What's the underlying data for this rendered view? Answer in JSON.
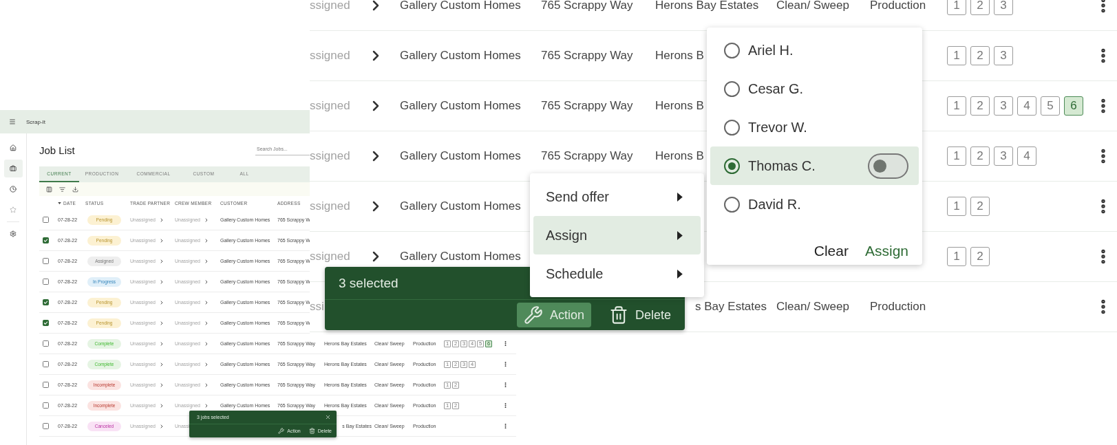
{
  "app": {
    "title": "Scrap-It",
    "nav": [
      {
        "selected": false
      },
      {
        "selected": true
      },
      {
        "selected": false
      },
      {
        "selected": false
      },
      {
        "selected": false
      }
    ],
    "page_title": "Job List",
    "search": {
      "placeholder": "Search Jobs..."
    },
    "tabs": [
      {
        "label": "CURRENT",
        "selected": true
      },
      {
        "label": "PRODUCTION",
        "selected": false
      },
      {
        "label": "COMMERCIAL",
        "selected": false
      },
      {
        "label": "CUSTOM",
        "selected": false
      },
      {
        "label": "ALL",
        "selected": false
      }
    ],
    "columns": [
      {
        "label": "DATE",
        "sorted": true
      },
      {
        "label": "STATUS",
        "sorted": false
      },
      {
        "label": "TRADE PARTNER",
        "sorted": false
      },
      {
        "label": "CREW MEMBER",
        "sorted": false
      },
      {
        "label": "CUSTOMER",
        "sorted": false
      },
      {
        "label": "ADDRESS",
        "sorted": false
      }
    ],
    "rows": [
      {
        "kind": "clipped",
        "checked": false,
        "date": "07-28-22",
        "status": {
          "label": "Pending",
          "color": "#fcf1d2"
        },
        "trade_partner": "Unassigned",
        "crew_member": "Unassigned",
        "customer": "Gallery Custom Homes",
        "address": "765 Scrappy W"
      },
      {
        "kind": "clipped",
        "checked": true,
        "date": "07-28-22",
        "status": {
          "label": "Pending",
          "color": "#fcf1d2"
        },
        "trade_partner": "Unassigned",
        "crew_member": "Unassigned",
        "customer": "Gallery Custom Homes",
        "address": "765 Scrappy W"
      },
      {
        "kind": "clipped",
        "checked": false,
        "date": "07-28-22",
        "status": {
          "label": "Assigned",
          "color": "#eeeeee"
        },
        "trade_partner": "Unassigned",
        "crew_member": "Unassigned",
        "customer": "Gallery Custom Homes",
        "address": "765 Scrappy W"
      },
      {
        "kind": "clipped",
        "checked": false,
        "date": "07-28-22",
        "status": {
          "label": "In Progress",
          "color": "#e0eff9"
        },
        "trade_partner": "Unassigned",
        "crew_member": "Unassigned",
        "customer": "Gallery Custom Homes",
        "address": "765 Scrappy W"
      },
      {
        "kind": "clipped",
        "checked": true,
        "date": "07-28-22",
        "status": {
          "label": "Pending",
          "color": "#fcf1d2"
        },
        "trade_partner": "Unassigned",
        "crew_member": "Unassigned",
        "customer": "Gallery Custom Homes",
        "address": "765 Scrappy W"
      },
      {
        "kind": "clipped",
        "checked": true,
        "date": "07-28-22",
        "status": {
          "label": "Pending",
          "color": "#fcf1d2"
        },
        "trade_partner": "Unassigned",
        "crew_member": "Unassigned",
        "customer": "Gallery Custom Homes",
        "address": "765 Scrappy W"
      },
      {
        "kind": "full",
        "checked": false,
        "date": "07-28-22",
        "status": {
          "label": "Complete",
          "color": "#e5f4e3"
        },
        "trade_partner": "Unassigned",
        "crew_member": "Unassigned",
        "customer": "Gallery Custom Homes",
        "address": "765 Scrappy Way",
        "subdivision": "Herons Bay Estates",
        "trade": "Clean/ Sweep",
        "category": "Production",
        "steps": [
          {
            "label": "1",
            "selected": false
          },
          {
            "label": "2",
            "selected": false
          },
          {
            "label": "3",
            "selected": false
          },
          {
            "label": "4",
            "selected": false
          },
          {
            "label": "5",
            "selected": false
          },
          {
            "label": "6",
            "selected": true
          }
        ],
        "menu": true
      },
      {
        "kind": "full",
        "checked": false,
        "date": "07-28-22",
        "status": {
          "label": "Complete",
          "color": "#e5f4e3"
        },
        "trade_partner": "Unassigned",
        "crew_member": "Unassigned",
        "customer": "Gallery Custom Homes",
        "address": "765 Scrappy Way",
        "subdivision": "Herons Bay Estates",
        "trade": "Clean/ Sweep",
        "category": "Production",
        "steps": [
          {
            "label": "1",
            "selected": false
          },
          {
            "label": "2",
            "selected": false
          },
          {
            "label": "3",
            "selected": false
          },
          {
            "label": "4",
            "selected": false
          }
        ],
        "menu": true
      },
      {
        "kind": "full",
        "checked": false,
        "date": "07-28-22",
        "status": {
          "label": "Incomplete",
          "color": "#fbe3e1"
        },
        "trade_partner": "Unassigned",
        "crew_member": "Unassigned",
        "customer": "Gallery Custom Homes",
        "address": "765 Scrappy Way",
        "subdivision": "Herons Bay Estates",
        "trade": "Clean/ Sweep",
        "category": "Production",
        "steps": [
          {
            "label": "1",
            "selected": false
          },
          {
            "label": "2",
            "selected": false
          }
        ],
        "menu": true
      },
      {
        "kind": "full",
        "checked": false,
        "date": "07-28-22",
        "status": {
          "label": "Incomplete",
          "color": "#fbe3e1"
        },
        "trade_partner": "Unassigned",
        "crew_member": "Unassigned",
        "customer": "Gallery Custom Homes",
        "address": "765 Scrappy Way",
        "subdivision": "Herons Bay Estates",
        "trade": "Clean/ Sweep",
        "category": "Production",
        "steps": [
          {
            "label": "1",
            "selected": false
          },
          {
            "label": "2",
            "selected": false
          }
        ],
        "menu": true
      },
      {
        "kind": "covered",
        "checked": false,
        "date": "07-28-22",
        "status": {
          "label": "Canceled",
          "color": "#f9e2f5"
        },
        "trade_partner": "Unassigned",
        "crew_member": "Unassi",
        "subdivision": "s Bay Estates",
        "trade": "Clean/ Sweep",
        "category": "Production",
        "menu": true
      }
    ],
    "snackbar": {
      "title": "3 jobs selected",
      "actions": [
        {
          "label": "Action",
          "kind": "action",
          "selected": false
        },
        {
          "label": "Delete",
          "kind": "delete",
          "selected": false
        }
      ]
    }
  },
  "zoom_view": {
    "rows": [
      {
        "kind": "full",
        "crew_member": "ssigned",
        "customer": "Gallery Custom Homes",
        "address": "765 Scrappy Way",
        "subdivision": "Herons Bay Estates",
        "trade": "Clean/ Sweep",
        "category": "Production",
        "steps": [
          {
            "label": "1",
            "selected": false
          },
          {
            "label": "2",
            "selected": false
          },
          {
            "label": "3",
            "selected": false
          }
        ],
        "menu": true
      },
      {
        "kind": "full",
        "crew_member": "ssigned",
        "customer": "Gallery Custom Homes",
        "address": "765 Scrappy Way",
        "subdivision": "Herons B",
        "steps": [
          {
            "label": "1",
            "selected": false
          },
          {
            "label": "2",
            "selected": false
          },
          {
            "label": "3",
            "selected": false
          }
        ],
        "menu": true
      },
      {
        "kind": "full",
        "crew_member": "ssigned",
        "customer": "Gallery Custom Homes",
        "address": "765 Scrappy Way",
        "subdivision": "Herons B",
        "steps": [
          {
            "label": "1",
            "selected": false
          },
          {
            "label": "2",
            "selected": false
          },
          {
            "label": "3",
            "selected": false
          },
          {
            "label": "4",
            "selected": false
          },
          {
            "label": "5",
            "selected": false
          },
          {
            "label": "6",
            "selected": true
          }
        ],
        "menu": true
      },
      {
        "kind": "full",
        "crew_member": "ssigned",
        "customer": "Gallery Custom Homes",
        "address": "765 Scrappy Way",
        "subdivision": "Herons B",
        "steps": [
          {
            "label": "1",
            "selected": false
          },
          {
            "label": "2",
            "selected": false
          },
          {
            "label": "3",
            "selected": false
          },
          {
            "label": "4",
            "selected": false
          }
        ],
        "menu": true
      },
      {
        "kind": "full",
        "crew_member": "ssigned",
        "customer": "Gallery Custom Homes",
        "steps": [
          {
            "label": "1",
            "selected": false
          },
          {
            "label": "2",
            "selected": false
          }
        ],
        "menu": true
      },
      {
        "kind": "full",
        "crew_member": "ssigned",
        "customer": "Gallery Custom Homes",
        "steps": [
          {
            "label": "1",
            "selected": false
          },
          {
            "label": "2",
            "selected": false
          }
        ],
        "menu": true
      },
      {
        "kind": "covered",
        "crew_member": "ssi",
        "subdivision": "s Bay Estates",
        "trade": "Clean/ Sweep",
        "category": "Production",
        "menu": true
      }
    ],
    "action_menu": [
      {
        "label": "Send offer",
        "selected": false
      },
      {
        "label": "Assign",
        "selected": true
      },
      {
        "label": "Schedule",
        "selected": false
      }
    ],
    "assign_popover": {
      "options": [
        {
          "label": "Ariel H.",
          "selected": false
        },
        {
          "label": "Cesar G.",
          "selected": false
        },
        {
          "label": "Trevor W.",
          "selected": false
        },
        {
          "label": "Thomas C.",
          "selected": true,
          "toggle": {
            "on": false
          }
        },
        {
          "label": "David R.",
          "selected": false
        }
      ],
      "buttons": [
        {
          "label": "Clear",
          "kind": "secondary"
        },
        {
          "label": "Assign",
          "kind": "primary"
        }
      ]
    },
    "snackbar": {
      "title": "3 selected",
      "actions": [
        {
          "label": "Action",
          "kind": "action",
          "selected": true
        },
        {
          "label": "Delete",
          "kind": "delete",
          "selected": false
        }
      ]
    }
  }
}
